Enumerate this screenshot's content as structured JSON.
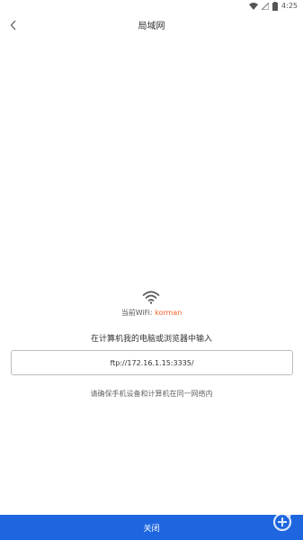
{
  "status_bar": {
    "time": "4:25",
    "icons": [
      "wifi-icon",
      "signal-off-icon",
      "battery-icon"
    ]
  },
  "header": {
    "back_icon": "chevron-left-icon",
    "title": "局域网"
  },
  "main": {
    "wifi_label": "当前WiFi: ",
    "wifi_name": "korman",
    "instruction": "在计算机我的电脑或浏览器中输入",
    "ftp_address": "ftp://172.16.1.15:3335/",
    "note": "请确保手机设备和计算机在同一网络内"
  },
  "footer": {
    "close_label": "关闭"
  },
  "colors": {
    "accent_blue": "#1e66e0",
    "wifi_name_orange": "#f0622d"
  }
}
